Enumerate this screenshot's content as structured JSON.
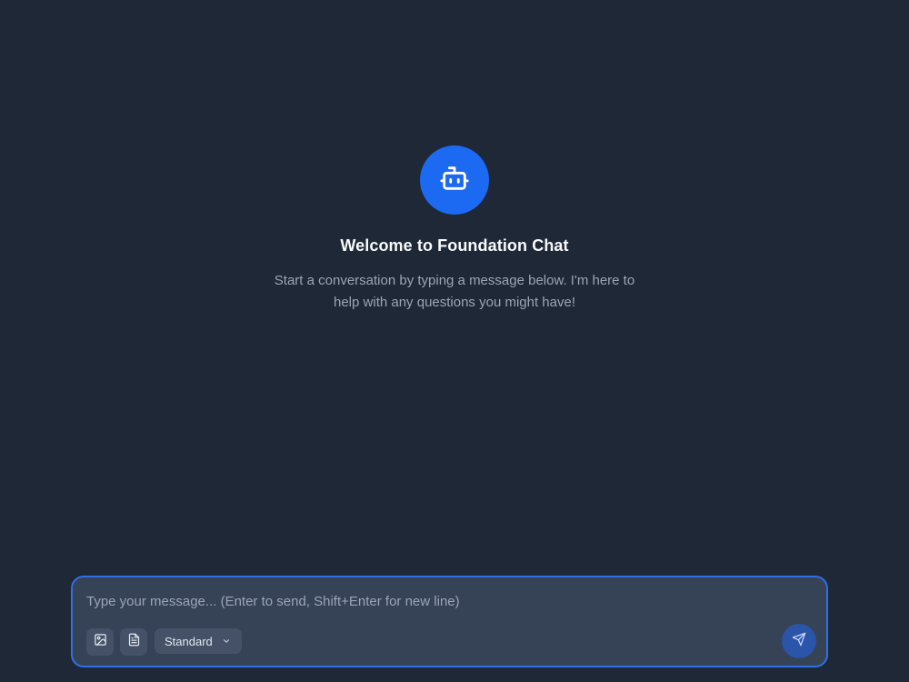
{
  "welcome": {
    "icon": "robot-icon",
    "title": "Welcome to Foundation Chat",
    "subtitle": "Start a conversation by typing a message below. I'm here to help with any questions you might have!"
  },
  "composer": {
    "placeholder": "Type your message... (Enter to send, Shift+Enter for new line)",
    "value": "",
    "image_icon": "image-icon",
    "file_icon": "file-text-icon",
    "mode": {
      "selected": "Standard",
      "icon": "chevron-down-icon"
    },
    "send_icon": "send-icon"
  },
  "colors": {
    "background": "#1e2837",
    "accent": "#1d6af2",
    "composer_border": "#2f6fe8",
    "composer_bg": "#364256",
    "send_button": "#2a55a8"
  }
}
